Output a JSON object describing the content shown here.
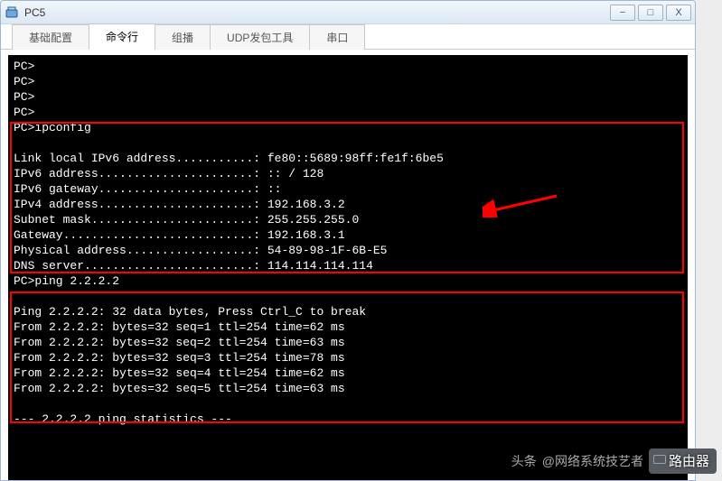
{
  "window": {
    "title": "PC5",
    "min": "−",
    "restore": "□",
    "close": "X"
  },
  "tabs": [
    {
      "label": "基础配置",
      "active": false
    },
    {
      "label": "命令行",
      "active": true
    },
    {
      "label": "组播",
      "active": false
    },
    {
      "label": "UDP发包工具",
      "active": false
    },
    {
      "label": "串口",
      "active": false
    }
  ],
  "terminal": {
    "pre_lines": [
      "PC>",
      "PC>",
      "PC>",
      "PC>"
    ],
    "ipconfig": {
      "cmd": "PC>ipconfig",
      "lines": [
        "",
        "Link local IPv6 address...........: fe80::5689:98ff:fe1f:6be5",
        "IPv6 address......................: :: / 128",
        "IPv6 gateway......................: ::",
        "IPv4 address......................: 192.168.3.2",
        "Subnet mask.......................: 255.255.255.0",
        "Gateway...........................: 192.168.3.1",
        "Physical address..................: 54-89-98-1F-6B-E5",
        "DNS server........................: 114.114.114.114"
      ]
    },
    "ping": {
      "cmd": "PC>ping 2.2.2.2",
      "lines": [
        "",
        "Ping 2.2.2.2: 32 data bytes, Press Ctrl_C to break",
        "From 2.2.2.2: bytes=32 seq=1 ttl=254 time=62 ms",
        "From 2.2.2.2: bytes=32 seq=2 ttl=254 time=63 ms",
        "From 2.2.2.2: bytes=32 seq=3 ttl=254 time=78 ms",
        "From 2.2.2.2: bytes=32 seq=4 ttl=254 time=62 ms",
        "From 2.2.2.2: bytes=32 seq=5 ttl=254 time=63 ms"
      ]
    },
    "tail_lines": [
      "",
      "--- 2.2.2.2 ping statistics ---"
    ]
  },
  "watermark": {
    "toutiao": "头条",
    "at": "@网络系统技艺者",
    "router": "路由器"
  }
}
